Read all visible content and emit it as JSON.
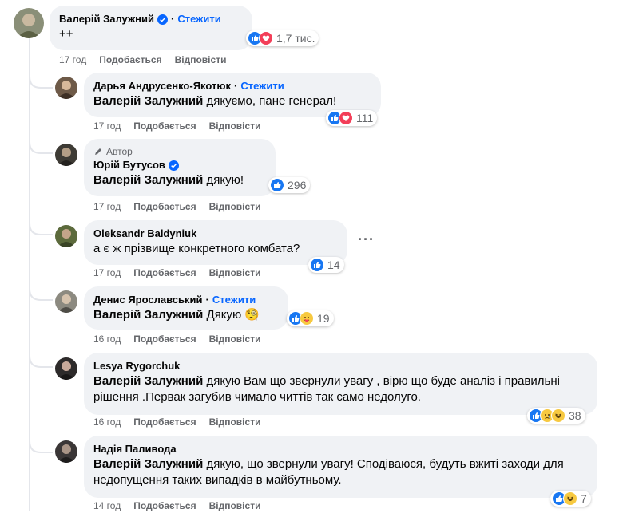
{
  "comments": [
    {
      "name": "Валерій Залужний",
      "follow": "Стежити",
      "text": "++",
      "time": "17 год",
      "like": "Подобається",
      "reply": "Відповісти",
      "count": "1,7 тис."
    },
    {
      "name": "Дарья Андрусенко-Якотюк",
      "follow": "Стежити",
      "tag": "Валерій Залужний",
      "text": " дякуємо, пане генерал!",
      "time": "17 год",
      "like": "Подобається",
      "reply": "Відповісти",
      "count": "111"
    },
    {
      "author_badge": "Автор",
      "name": "Юрій Бутусов",
      "tag": "Валерій Залужний",
      "text": " дякую!",
      "time": "17 год",
      "like": "Подобається",
      "reply": "Відповісти",
      "count": "296"
    },
    {
      "name": "Oleksandr Baldyniuk",
      "text": "а є ж прізвище конкретного комбата?",
      "time": "17 год",
      "like": "Подобається",
      "reply": "Відповісти",
      "count": "14"
    },
    {
      "name": "Денис Ярославський",
      "follow": "Стежити",
      "tag": "Валерій Залужний",
      "text": " Дякую 🧐",
      "time": "16 год",
      "like": "Подобається",
      "reply": "Відповісти",
      "count": "19"
    },
    {
      "name": "Lesya Rygorchuk",
      "tag": "Валерій Залужний",
      "text": " дякую Вам що звернули увагу , вірю що буде аналіз і правильні рішення .Первак загубив чимало читтів так само недолуго.",
      "time": "16 год",
      "like": "Подобається",
      "reply": "Відповісти",
      "count": "38"
    },
    {
      "name": "Надія Паливода",
      "tag": "Валерій Залужний",
      "text": " дякую, що звернули увагу! Сподіваюся, будуть вжиті заходи для недопущення таких випадків в майбутньому.",
      "time": "14 год",
      "like": "Подобається",
      "reply": "Відповісти",
      "count": "7"
    }
  ],
  "colors": {
    "bubble": "#f0f2f5",
    "link": "#0866ff",
    "meta": "#65676b",
    "like": "#1877f2",
    "love": "#f33e58"
  },
  "icons": [
    "verified-badge-icon",
    "pen-icon",
    "like-reaction-icon",
    "love-reaction-icon",
    "sad-reaction-icon",
    "haha-reaction-icon",
    "care-reaction-icon",
    "more-options-icon"
  ]
}
